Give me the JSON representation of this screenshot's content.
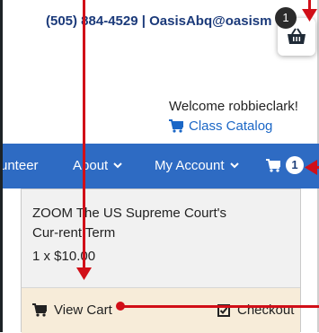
{
  "header": {
    "contact": "(505) 884-4529 | OasisAbq@oasism"
  },
  "floating_cart": {
    "count": "1",
    "icon": "basket-icon"
  },
  "user": {
    "welcome": "Welcome robbieclark!",
    "catalog_link": "Class Catalog"
  },
  "nav": {
    "items": [
      {
        "label": "unteer"
      },
      {
        "label": "About"
      },
      {
        "label": "My Account"
      }
    ],
    "cart_count": "1"
  },
  "cart_dropdown": {
    "item_title": "ZOOM The US Supreme Court's Cur-rent Term",
    "item_quantity": "1 x $10.00",
    "view_cart_label": "View Cart",
    "checkout_label": "Checkout"
  },
  "colors": {
    "nav_blue": "#2e6bc3",
    "link_blue": "#1b67c6",
    "annotation_red": "#d10f18"
  }
}
